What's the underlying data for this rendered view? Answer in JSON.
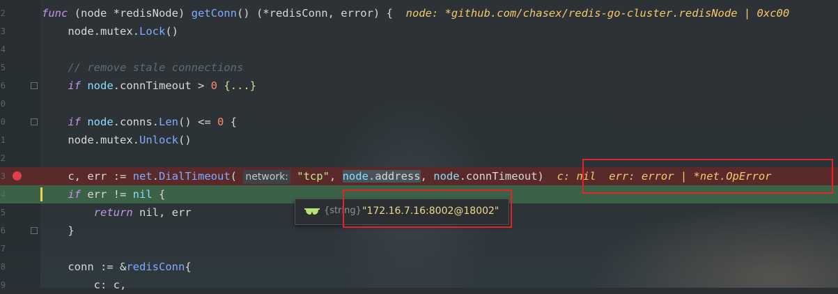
{
  "editor": {
    "lines": [
      {
        "n": "2",
        "html": "<span class=\"kw\">func</span> (node *redisNode) <span class=\"fn\">getConn</span>() (*redisConn, error) {  <span class=\"inline-debug\">node: *github.com/chasex/redis-go-cluster.redisNode | 0xc00</span>"
      },
      {
        "n": "3",
        "html": "    node.mutex.<span class=\"fn\">Lock</span>()"
      },
      {
        "n": "4",
        "html": ""
      },
      {
        "n": "5",
        "html": "    <span class=\"cmt\">// remove stale connections</span>"
      },
      {
        "n": "6",
        "html": "    <span class=\"kw\">if</span> <span class=\"var\">node</span>.connTimeout &gt; <span class=\"num\">0</span> <span class=\"str\">{...}</span>"
      },
      {
        "n": "0",
        "html": ""
      },
      {
        "n": "0",
        "html": "    <span class=\"kw\">if</span> <span class=\"var\">node</span>.conns.<span class=\"fn\">Len</span>() &lt;= <span class=\"num\">0</span> {"
      },
      {
        "n": "1",
        "html": "    node.mutex.<span class=\"fn\">Unlock</span>()"
      },
      {
        "n": "2",
        "html": ""
      },
      {
        "n": "3",
        "html": "    c, err := <span class=\"fn\">net</span>.<span class=\"fn\">DialTimeout</span>( <span class=\"hint-bg\">network:</span> <span class=\"str\">\"tcp\"</span>, <span class=\"selword\"><span class=\"var\">node</span>.address</span>, <span class=\"var\">node</span>.connTimeout)  <span class=\"inline-debug\">c: nil  err: error | *net.OpError</span>"
      },
      {
        "n": "4",
        "html": "    <span class=\"kw\">if</span> err != <span class=\"var\">nil</span> {"
      },
      {
        "n": "5",
        "html": "        <span class=\"kw\">return</span> nil, err"
      },
      {
        "n": "6",
        "html": "    }"
      },
      {
        "n": "7",
        "html": ""
      },
      {
        "n": "8",
        "html": "    conn := &amp;<span class=\"fn\">redisConn</span>{"
      },
      {
        "n": "9",
        "html": "        c: c,"
      }
    ]
  },
  "tooltip": {
    "type": "{string}",
    "value": "\"172.16.7.16:8002@18002\""
  },
  "colors": {
    "breakpoint": "#e0404a",
    "execution_line": "#3b6147",
    "highlight_box": "#e5232b"
  },
  "icons": {
    "tooltip_icon": "glasses-icon",
    "breakpoint": "breakpoint-dot-icon"
  }
}
